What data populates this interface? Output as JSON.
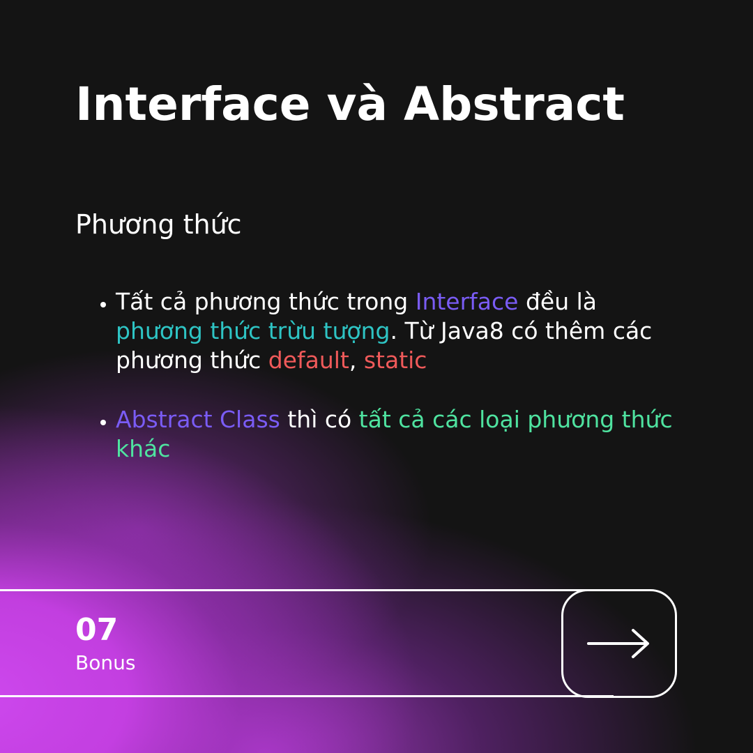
{
  "slide": {
    "title": "Interface và Abstract",
    "subtitle": "Phương thức"
  },
  "bullets": [
    {
      "parts": [
        {
          "text": "Tất cả phương thức trong ",
          "color": "white"
        },
        {
          "text": "Interface",
          "color": "purple"
        },
        {
          "text": " đều là ",
          "color": "white"
        },
        {
          "text": "phương thức trừu tượng",
          "color": "teal"
        },
        {
          "text": ". Từ Java8 có thêm các phương thức ",
          "color": "white"
        },
        {
          "text": "default",
          "color": "red"
        },
        {
          "text": ", ",
          "color": "white"
        },
        {
          "text": "static",
          "color": "red"
        }
      ]
    },
    {
      "parts": [
        {
          "text": "Abstract Class",
          "color": "purple"
        },
        {
          "text": " thì có ",
          "color": "white"
        },
        {
          "text": "tất cả các loại phương thức khác",
          "color": "green"
        }
      ]
    }
  ],
  "footer": {
    "page_number": "07",
    "label": "Bonus",
    "next_icon": "arrow-right-icon"
  },
  "colors": {
    "background": "#141414",
    "purple": "#7a5cf5",
    "teal": "#2ec4c4",
    "red": "#f05a5a",
    "green": "#4fe3a0",
    "glow": "#c848e6"
  }
}
